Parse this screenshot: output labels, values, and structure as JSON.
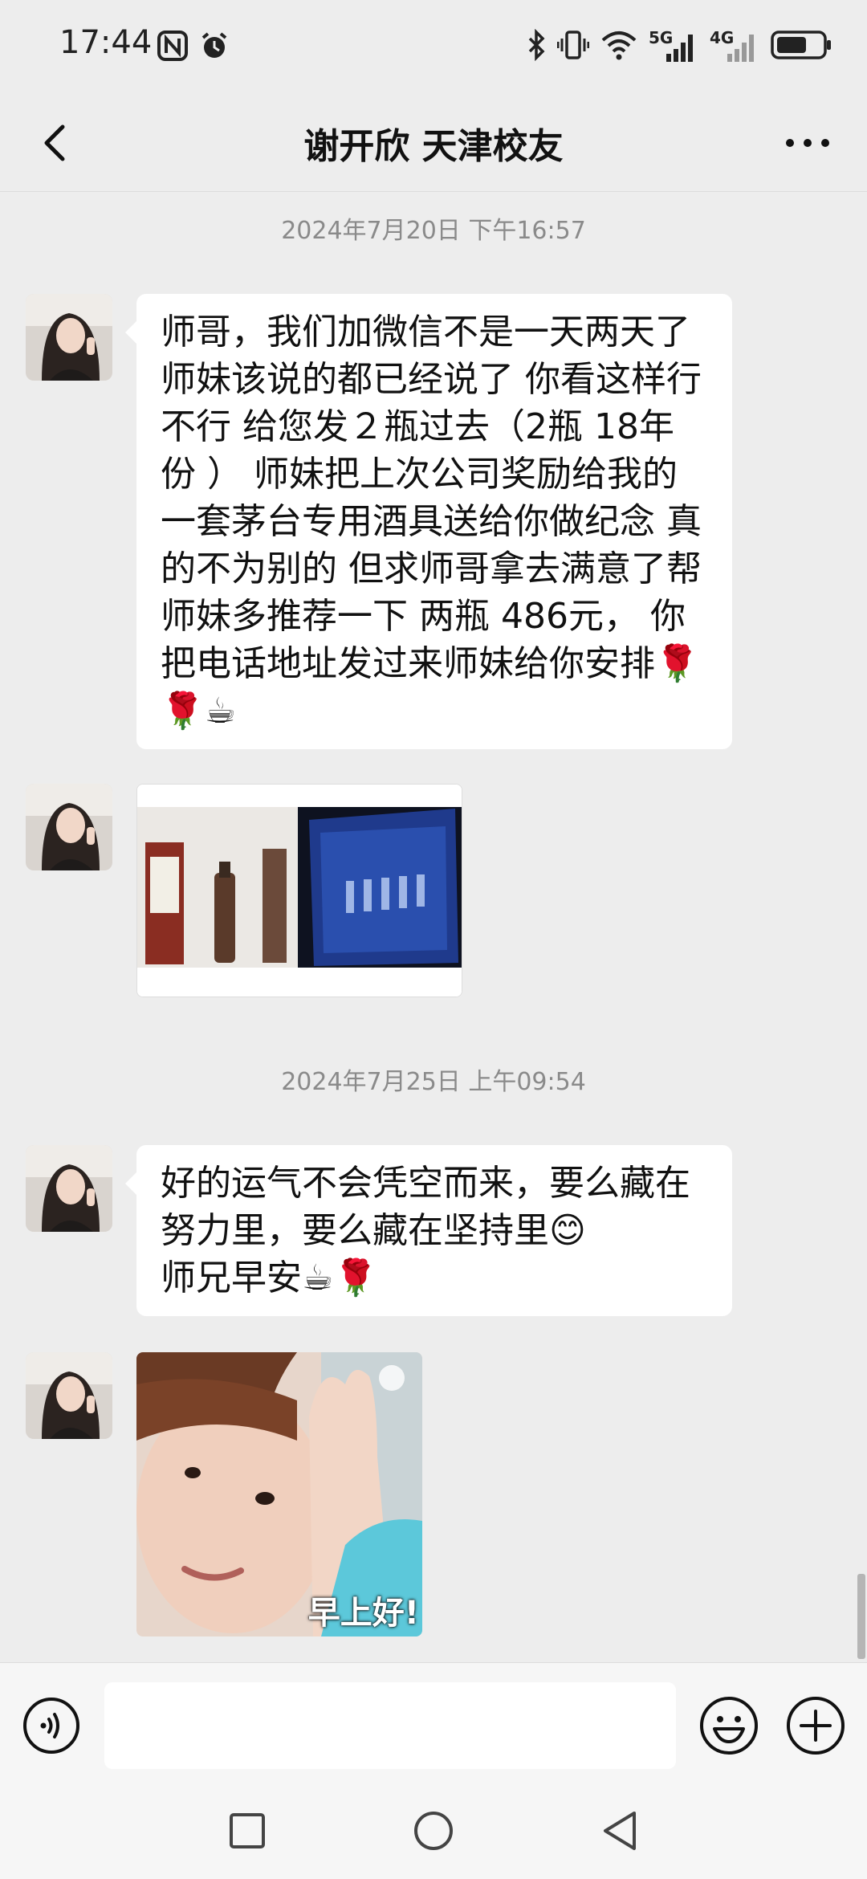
{
  "status_bar": {
    "time": "17:44",
    "left_icons": [
      "nfc-icon",
      "alarm-icon"
    ],
    "right_icons": [
      "bluetooth-icon",
      "vibrate-icon",
      "wifi-icon",
      "signal-5g-icon",
      "signal-4g-icon",
      "battery-icon"
    ],
    "network_5g": "5G",
    "network_4g": "4G"
  },
  "header": {
    "title": "谢开欣 天津校友",
    "back_icon": "chevron-left-icon",
    "more_icon": "more-dots-icon"
  },
  "messages": {
    "timestamp1": "2024年7月20日 下午16:57",
    "text1": "师哥，我们加微信不是一天两天了 师妹该说的都已经说了 你看这样行不行 给您发２瓶过去（2瓶 18年份 ） 师妹把上次公司奖励给我的一套茅台专用酒具送给你做纪念 真的不为别的 但求师哥拿去满意了帮师妹多推荐一下 两瓶 486元， 你把电话地址发过来师妹给你安排🌹🌹☕",
    "timestamp2": "2024年7月25日 上午09:54",
    "text2_line1": "好的运气不会凭空而来，要么藏在努力里，要么藏在坚持里😊",
    "text2_line2": "师兄早安☕🌹",
    "sticker_caption": "早上好!"
  },
  "input_bar": {
    "placeholder": "",
    "voice_icon": "voice-icon",
    "emoji_icon": "emoji-icon",
    "plus_icon": "plus-icon"
  },
  "nav_bar": {
    "icons": [
      "square-nav-icon",
      "circle-home-icon",
      "triangle-back-icon"
    ]
  },
  "colors": {
    "background": "#ededed",
    "bubble": "#ffffff",
    "timestamp": "#8a8a8a"
  }
}
